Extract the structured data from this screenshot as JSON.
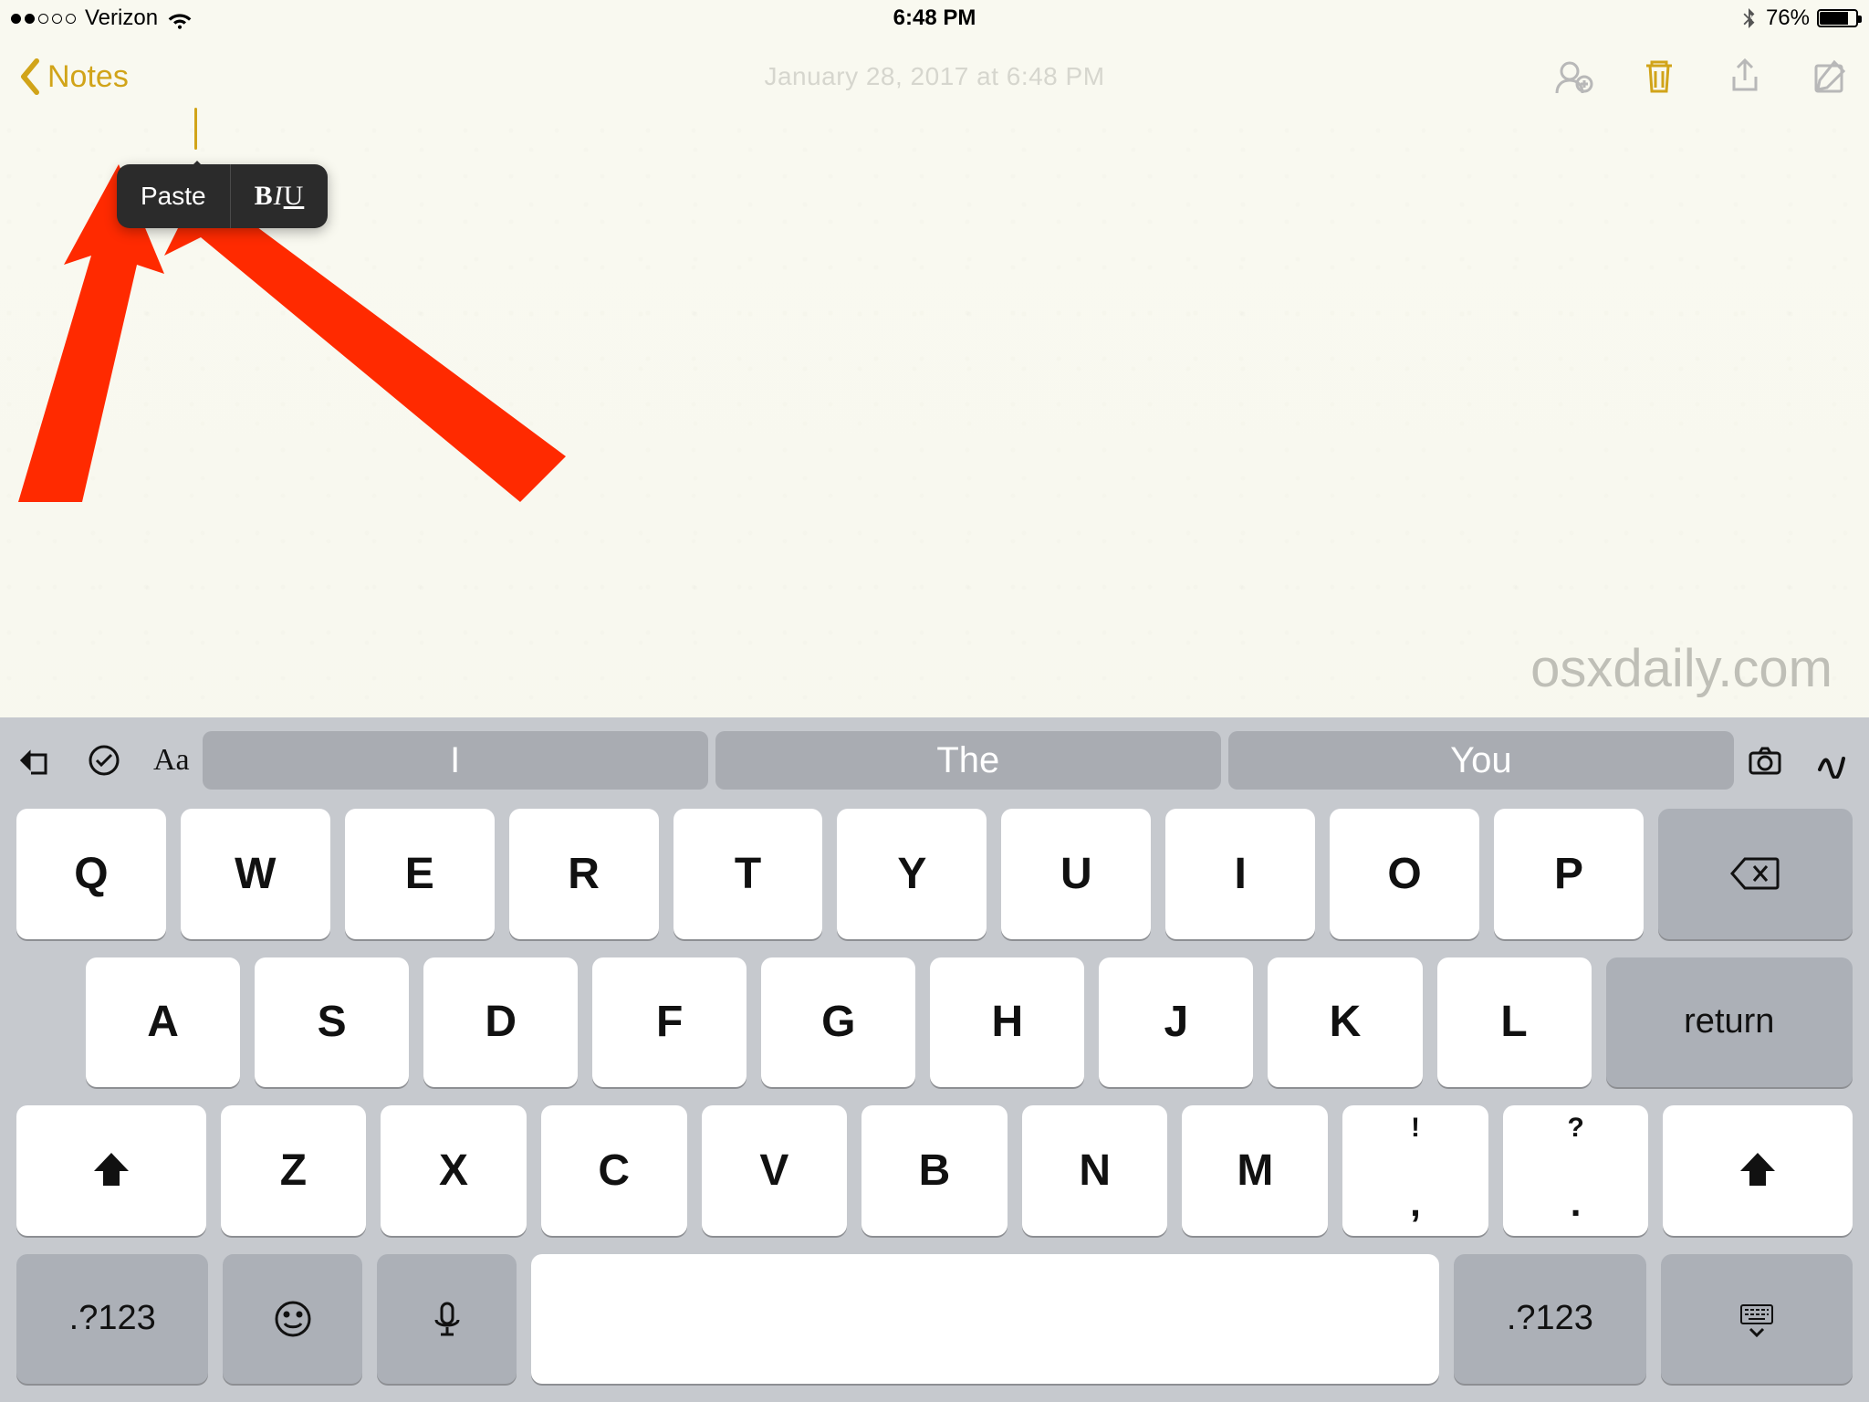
{
  "status": {
    "carrier": "Verizon",
    "time": "6:48 PM",
    "battery_pct": "76%"
  },
  "nav": {
    "back_label": "Notes",
    "date_label": "January 28, 2017 at 6:48 PM"
  },
  "context_menu": {
    "paste": "Paste"
  },
  "watermark": "osxdaily.com",
  "predict": {
    "s1": "I",
    "s2": "The",
    "s3": "You"
  },
  "keys": {
    "row1": [
      "Q",
      "W",
      "E",
      "R",
      "T",
      "Y",
      "U",
      "I",
      "O",
      "P"
    ],
    "row2": [
      "A",
      "S",
      "D",
      "F",
      "G",
      "H",
      "J",
      "K",
      "L"
    ],
    "row3": [
      "Z",
      "X",
      "C",
      "V",
      "B",
      "N",
      "M"
    ],
    "punct1_alt": "!",
    "punct1_main": ",",
    "punct2_alt": "?",
    "punct2_main": ".",
    "return": "return",
    "numbers": ".?123"
  }
}
